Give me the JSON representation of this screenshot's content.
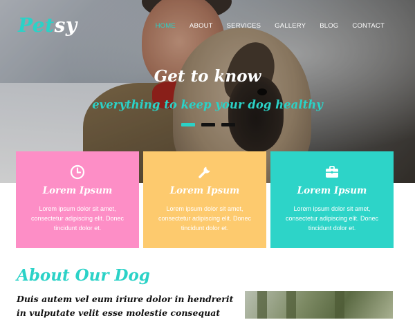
{
  "brand": {
    "logo_part1": "Pet",
    "logo_part2": "sy",
    "accent_color": "#2bd2c7"
  },
  "nav": {
    "items": [
      {
        "label": "HOME",
        "active": true
      },
      {
        "label": "ABOUT",
        "active": false
      },
      {
        "label": "SERVICES",
        "active": false
      },
      {
        "label": "GALLERY",
        "active": false
      },
      {
        "label": "BLOG",
        "active": false
      },
      {
        "label": "CONTACT",
        "active": false
      }
    ]
  },
  "hero": {
    "title": "Get to know",
    "subtitle": "everything to keep your dog healthy",
    "slides": 3,
    "active_slide": 1
  },
  "features": [
    {
      "icon": "clock-icon",
      "title": "Lorem Ipsum",
      "text": "Lorem ipsum dolor sit amet, consectetur adipiscing elit. Donec tincidunt dolor et.",
      "color": "#fd8ec6"
    },
    {
      "icon": "wrench-icon",
      "title": "Lorem Ipsum",
      "text": "Lorem ipsum dolor sit amet, consectetur adipiscing elit. Donec tincidunt dolor et.",
      "color": "#fdca6e"
    },
    {
      "icon": "briefcase-icon",
      "title": "Lorem Ipsum",
      "text": "Lorem ipsum dolor sit amet, consectetur adipiscing elit. Donec tincidunt dolor et.",
      "color": "#2dd4c8"
    }
  ],
  "about": {
    "title": "About Our Dog",
    "text": "Duis autem vel eum iriure dolor in hendrerit in vulputate velit esse molestie consequat"
  }
}
